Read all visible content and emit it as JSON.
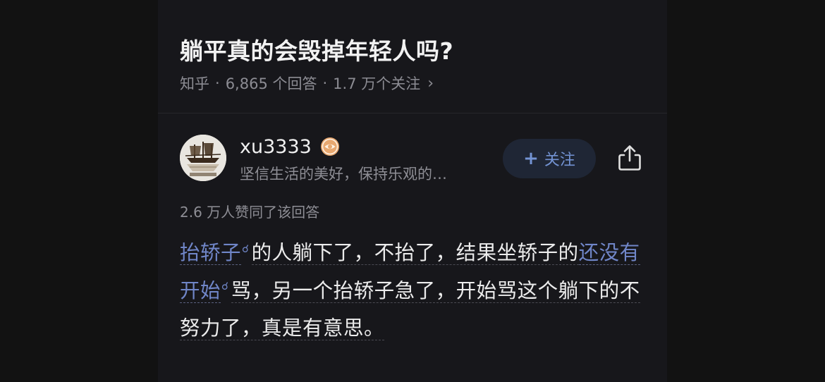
{
  "question": {
    "title": "躺平真的会毁掉年轻人吗?",
    "source": "知乎",
    "separator": "·",
    "answers_count": "6,865 个回答",
    "followers_count": "1.7 万个关注",
    "chevron": "›"
  },
  "author": {
    "name": "xu3333",
    "bio": "坚信生活的美好，保持乐观的…",
    "badge_icon": "eye-badge-icon",
    "avatar_icon": "ship-avatar-image"
  },
  "actions": {
    "follow_label": "关注",
    "follow_plus": "+",
    "share_icon": "share-icon"
  },
  "answer": {
    "votes": "2.6 万人赞同了该回答",
    "segments": [
      {
        "text": "抬轿子",
        "type": "link"
      },
      {
        "text": "的人躺下了，不抬了，结果坐轿子的",
        "type": "plain"
      },
      {
        "text": "还没有开始",
        "type": "link"
      },
      {
        "text": "骂，另一个抬轿子急了，开始骂这个躺下的不努力了，真是有意思。",
        "type": "plain"
      }
    ]
  },
  "colors": {
    "background": "#121212",
    "panel": "#17171b",
    "link": "#7086c8",
    "follow_bg": "#1f2635",
    "follow_text": "#7393d3",
    "badge": "#e8a870"
  }
}
